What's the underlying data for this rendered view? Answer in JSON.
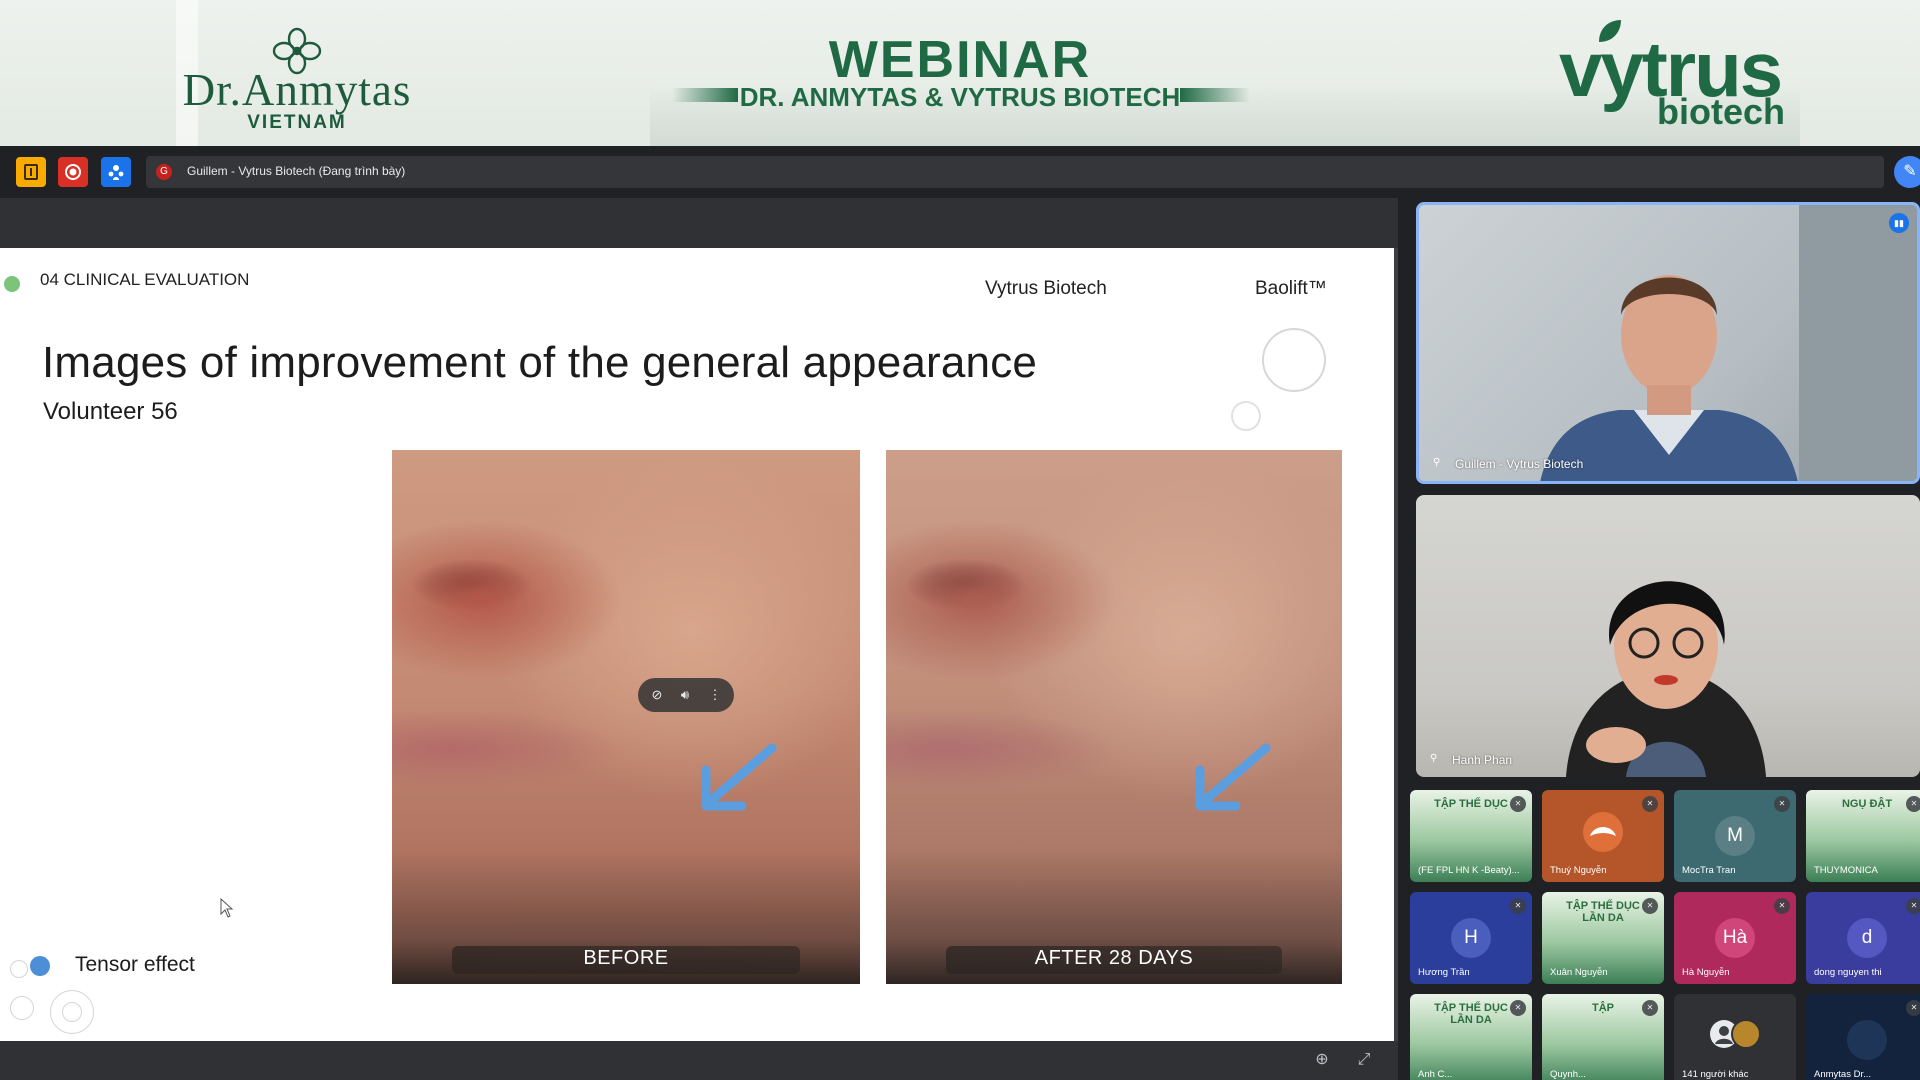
{
  "banner": {
    "left_brand": "Dr.Anmytas",
    "left_sub": "VIETNAM",
    "title": "WEBINAR",
    "subtitle": "DR. ANMYTAS & VYTRUS BIOTECH",
    "right_brand": "vytrus",
    "right_sub": "biotech",
    "brand_color": "#1f6a44"
  },
  "topbar": {
    "presenter_initial": "G",
    "presenting_text": "Guillem - Vytrus Biotech (Đang trình bày)",
    "icons": [
      "notes-icon",
      "record-icon",
      "people-icon",
      "edit-icon"
    ]
  },
  "slide": {
    "section": "04 CLINICAL EVALUATION",
    "company": "Vytrus Biotech",
    "product": "Baolift™",
    "title": "Images of improvement of the general appearance",
    "subtitle": "Volunteer 56",
    "before_label": "BEFORE",
    "after_label": "AFTER 28 DAYS",
    "legend_label": "Tensor effect",
    "legend_color": "#4c8fd6",
    "arrow_color": "#5a9ee0"
  },
  "participants": {
    "speakers": [
      {
        "name": "Guillem - Vytrus Biotech",
        "active": true
      },
      {
        "name": "Hanh Phan",
        "active": false
      }
    ],
    "grid": [
      {
        "name": "(FE FPL HN K -Beaty)...",
        "type": "poster",
        "poster_text": "TẬP THỂ DỤC"
      },
      {
        "name": "Thuý Nguyễn",
        "type": "logo",
        "bg": "#b5562a"
      },
      {
        "name": "MocTra Tran",
        "type": "avatar",
        "initial": "M",
        "bg": "#3c6a70",
        "circle": "#5b7f84"
      },
      {
        "name": "THUYMONICA",
        "type": "poster",
        "poster_text": "NGỤ ĐẬT"
      },
      {
        "name": "Hương Trần",
        "type": "avatar",
        "initial": "H",
        "bg": "#2b3e9b",
        "circle": "#4a5fbd"
      },
      {
        "name": "Xuân Nguyễn",
        "type": "poster",
        "poster_text": "TẬP THỂ DỤC LẦN DA"
      },
      {
        "name": "Hà Nguyễn",
        "type": "avatar",
        "initial": "Hà",
        "bg": "#b0295c",
        "circle": "#d0467a"
      },
      {
        "name": "dong nguyen thi",
        "type": "avatar",
        "initial": "d",
        "bg": "#3a3c9e",
        "circle": "#5558c0"
      },
      {
        "name": "Anh C...",
        "type": "poster",
        "poster_text": "TẬP THỂ DỤC LẦN DA"
      },
      {
        "name": "Quynh...",
        "type": "poster",
        "poster_text": "TẬP"
      },
      {
        "name": "141 người khác",
        "type": "more",
        "bg": "#303134"
      },
      {
        "name": "Anmytas Dr...",
        "type": "dark",
        "bg": "#14233d"
      }
    ]
  },
  "controls": {
    "zoom_icon": "zoom-in-icon",
    "fullscreen_icon": "fullscreen-icon"
  }
}
